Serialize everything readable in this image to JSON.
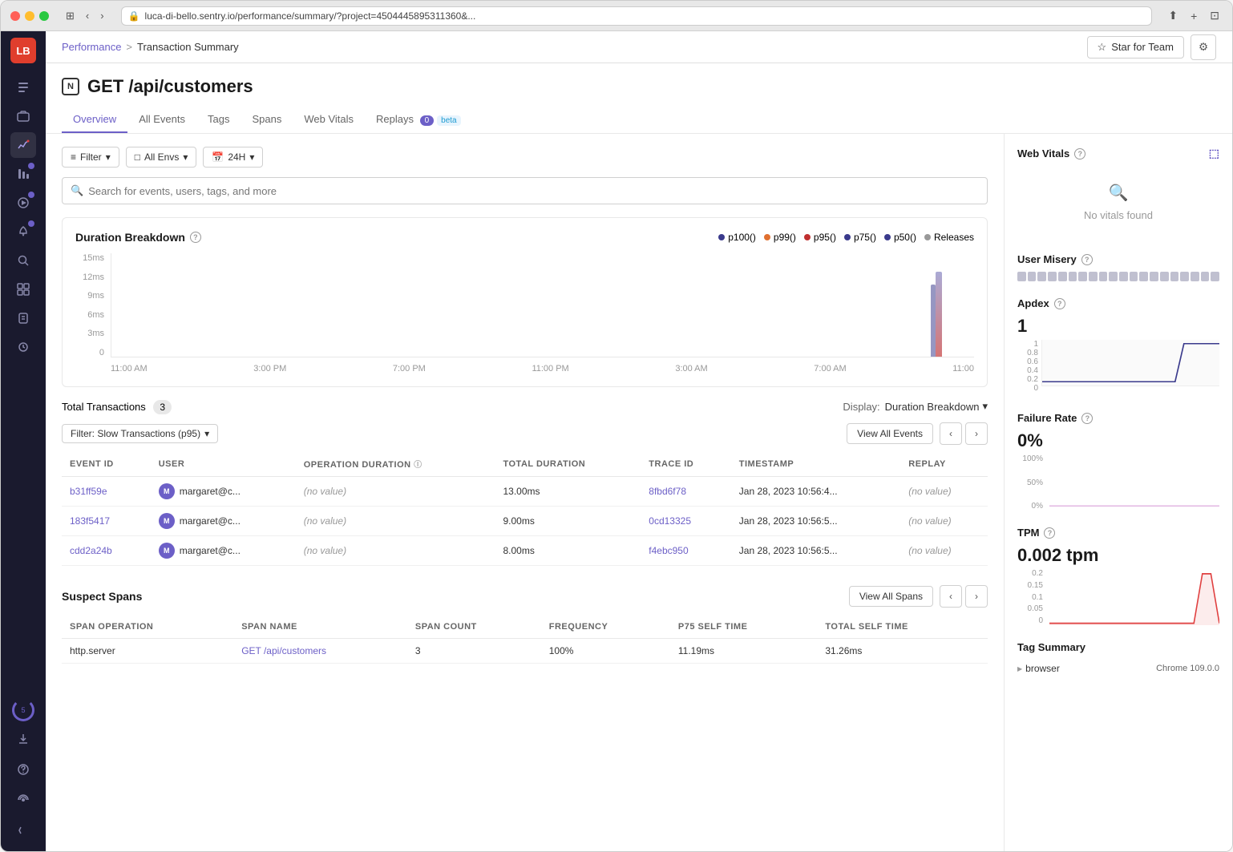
{
  "window": {
    "title": "luca-di-bello.sentry.io/performance/summary/?project=4504445895311360&..."
  },
  "breadcrumb": {
    "parent": "Performance",
    "separator": ">",
    "current": "Transaction Summary"
  },
  "page": {
    "badge": "N",
    "title": "GET /api/customers"
  },
  "star_button": "Star for Team",
  "tabs": [
    {
      "label": "Overview",
      "active": true
    },
    {
      "label": "All Events",
      "active": false
    },
    {
      "label": "Tags",
      "active": false
    },
    {
      "label": "Spans",
      "active": false
    },
    {
      "label": "Web Vitals",
      "active": false
    },
    {
      "label": "Replays",
      "active": false,
      "badge": "0",
      "beta": true
    }
  ],
  "filters": {
    "filter_label": "Filter",
    "env_label": "All Envs",
    "time_label": "24H",
    "search_placeholder": "Search for events, users, tags, and more"
  },
  "chart": {
    "title": "Duration Breakdown",
    "legend": [
      {
        "label": "p100()",
        "color": "#3a3a8c"
      },
      {
        "label": "p99()",
        "color": "#e07030"
      },
      {
        "label": "p95()",
        "color": "#c03030"
      },
      {
        "label": "p75()",
        "color": "#3a3a8c"
      },
      {
        "label": "p50()",
        "color": "#3a3a8c"
      },
      {
        "label": "Releases",
        "color": "#999"
      }
    ],
    "y_axis": [
      "15ms",
      "12ms",
      "9ms",
      "6ms",
      "3ms",
      "0"
    ],
    "x_axis": [
      "11:00 AM",
      "3:00 PM",
      "7:00 PM",
      "11:00 PM",
      "3:00 AM",
      "7:00 AM",
      "11:00"
    ]
  },
  "transactions": {
    "total_label": "Total Transactions",
    "total_count": "3",
    "display_label": "Display:",
    "display_value": "Duration Breakdown"
  },
  "table": {
    "filter_label": "Filter: Slow Transactions (p95)",
    "view_all_label": "View All Events",
    "columns": [
      "EVENT ID",
      "USER",
      "OPERATION DURATION",
      "TOTAL DURATION",
      "TRACE ID",
      "TIMESTAMP",
      "REPLAY"
    ],
    "rows": [
      {
        "event_id": "b31ff59e",
        "user_initial": "M",
        "user": "margaret@c...",
        "op_duration": "(no value)",
        "total_duration": "13.00ms",
        "trace_id": "8fbd6f78",
        "timestamp": "Jan 28, 2023 10:56:4...",
        "replay": "(no value)"
      },
      {
        "event_id": "183f5417",
        "user_initial": "M",
        "user": "margaret@c...",
        "op_duration": "(no value)",
        "total_duration": "9.00ms",
        "trace_id": "0cd13325",
        "timestamp": "Jan 28, 2023 10:56:5...",
        "replay": "(no value)"
      },
      {
        "event_id": "cdd2a24b",
        "user_initial": "M",
        "user": "margaret@c...",
        "op_duration": "(no value)",
        "total_duration": "8.00ms",
        "trace_id": "f4ebc950",
        "timestamp": "Jan 28, 2023 10:56:5...",
        "replay": "(no value)"
      }
    ]
  },
  "suspect_spans": {
    "title": "Suspect Spans",
    "view_all_label": "View All Spans",
    "columns": [
      "SPAN OPERATION",
      "SPAN NAME",
      "SPAN COUNT",
      "FREQUENCY",
      "P75 SELF TIME",
      "TOTAL SELF TIME"
    ],
    "rows": [
      {
        "operation": "http.server",
        "name": "GET /api/customers",
        "count": "3",
        "frequency": "100%",
        "p75": "11.19ms",
        "total": "31.26ms"
      }
    ]
  },
  "right_panel": {
    "web_vitals": {
      "title": "Web Vitals",
      "no_vitals_text": "No vitals found"
    },
    "user_misery": {
      "title": "User Misery"
    },
    "apdex": {
      "title": "Apdex",
      "value": "1",
      "y_labels": [
        "1",
        "0.8",
        "0.6",
        "0.4",
        "0.2",
        "0"
      ]
    },
    "failure_rate": {
      "title": "Failure Rate",
      "value": "0%",
      "y_labels": [
        "100%",
        "50%",
        "0%"
      ]
    },
    "tpm": {
      "title": "TPM",
      "value": "0.002 tpm",
      "y_labels": [
        "0.2",
        "0.15",
        "0.1",
        "0.05",
        "0"
      ]
    },
    "tag_summary": {
      "title": "Tag Summary",
      "rows": [
        {
          "key": "browser",
          "value": "Chrome 109.0.0"
        }
      ]
    }
  },
  "sidebar": {
    "avatar": "LB",
    "icons": [
      "☰",
      "📁",
      "⚡",
      "📊",
      "▶",
      "🔔",
      "🔥",
      "🔍",
      "▦",
      "💼",
      "🛡",
      "⚙"
    ]
  }
}
